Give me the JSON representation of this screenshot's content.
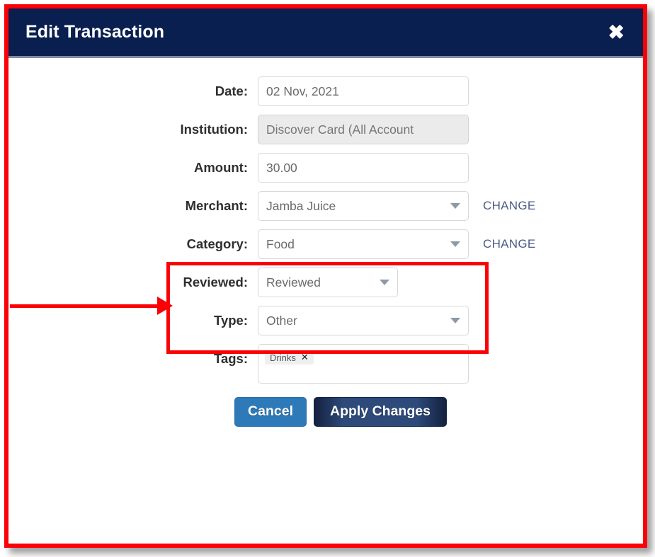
{
  "modal": {
    "title": "Edit Transaction",
    "close_icon": "close-icon",
    "close_glyph": "✖"
  },
  "form": {
    "fields": [
      {
        "key": "date",
        "label": "Date:",
        "value": "02 Nov, 2021",
        "type": "text",
        "disabled": false,
        "has_change_link": false
      },
      {
        "key": "institution",
        "label": "Institution:",
        "value": "Discover Card (All Account",
        "type": "text",
        "disabled": true,
        "has_change_link": false
      },
      {
        "key": "amount",
        "label": "Amount:",
        "value": "30.00",
        "type": "text",
        "disabled": false,
        "has_change_link": false
      },
      {
        "key": "merchant",
        "label": "Merchant:",
        "value": "Jamba Juice",
        "type": "select",
        "disabled": false,
        "has_change_link": true
      },
      {
        "key": "category",
        "label": "Category:",
        "value": "Food",
        "type": "select",
        "disabled": false,
        "has_change_link": true
      },
      {
        "key": "reviewed",
        "label": "Reviewed:",
        "value": "Reviewed",
        "type": "select",
        "disabled": false,
        "has_change_link": false
      },
      {
        "key": "type",
        "label": "Type:",
        "value": "Other",
        "type": "select",
        "disabled": false,
        "has_change_link": false
      }
    ],
    "tags_label": "Tags:",
    "tags": [
      {
        "name": "Drinks",
        "remove_glyph": "✕"
      }
    ],
    "change_link_label": "CHANGE"
  },
  "buttons": {
    "cancel": "Cancel",
    "apply": "Apply Changes"
  },
  "colors": {
    "header_navy": "#081f4f",
    "annotation_red": "#fb0006",
    "cancel_blue": "#2e7ab8",
    "apply_navy": "#2d4a7a",
    "change_link": "#4a5c86",
    "disabled_field": "#ebebeb"
  }
}
